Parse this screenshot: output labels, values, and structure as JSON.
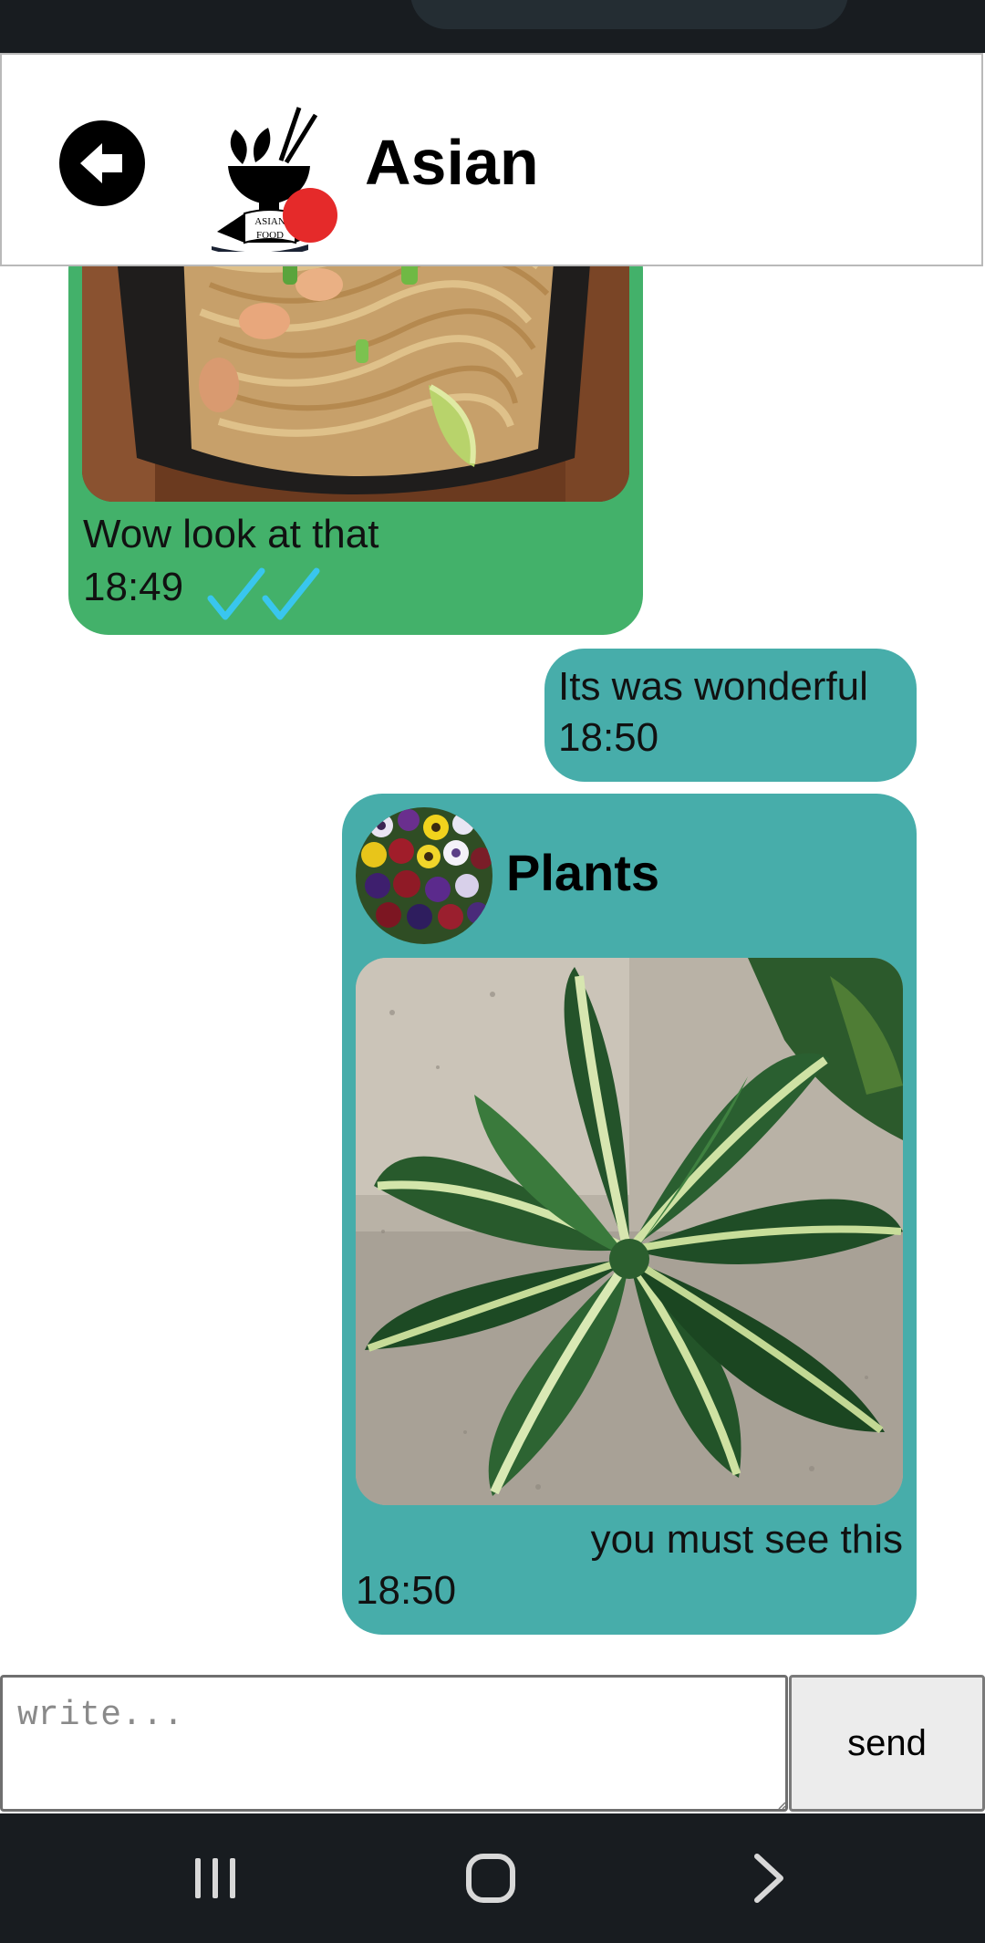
{
  "header": {
    "title": "Asian",
    "logo_text_top": "ASIAN",
    "logo_text_bottom": "FOOD",
    "back_icon": "arrow-left-circle-icon"
  },
  "messages": [
    {
      "direction": "received",
      "kind": "image",
      "text": "Wow look at that",
      "time": "18:49",
      "status": "read",
      "status_icon": "double-check-icon",
      "bubble_color": "#43b16a",
      "tick_color": "#39c6ee"
    },
    {
      "direction": "sent",
      "kind": "text",
      "text": "Its was wonderful",
      "time": "18:50",
      "bubble_color": "#47adaa"
    },
    {
      "direction": "sent",
      "kind": "shared-post",
      "post_title": "Plants",
      "text": "you must see this",
      "time": "18:50",
      "bubble_color": "#47adaa"
    }
  ],
  "composer": {
    "placeholder": "write...",
    "value": "",
    "send_label": "send"
  },
  "navbar": {
    "recents_icon": "recents-icon",
    "home_icon": "home-icon",
    "back_icon": "chevron-right-icon"
  },
  "colors": {
    "status_bar": "#181c20",
    "unread_dot": "#e52a2a"
  }
}
